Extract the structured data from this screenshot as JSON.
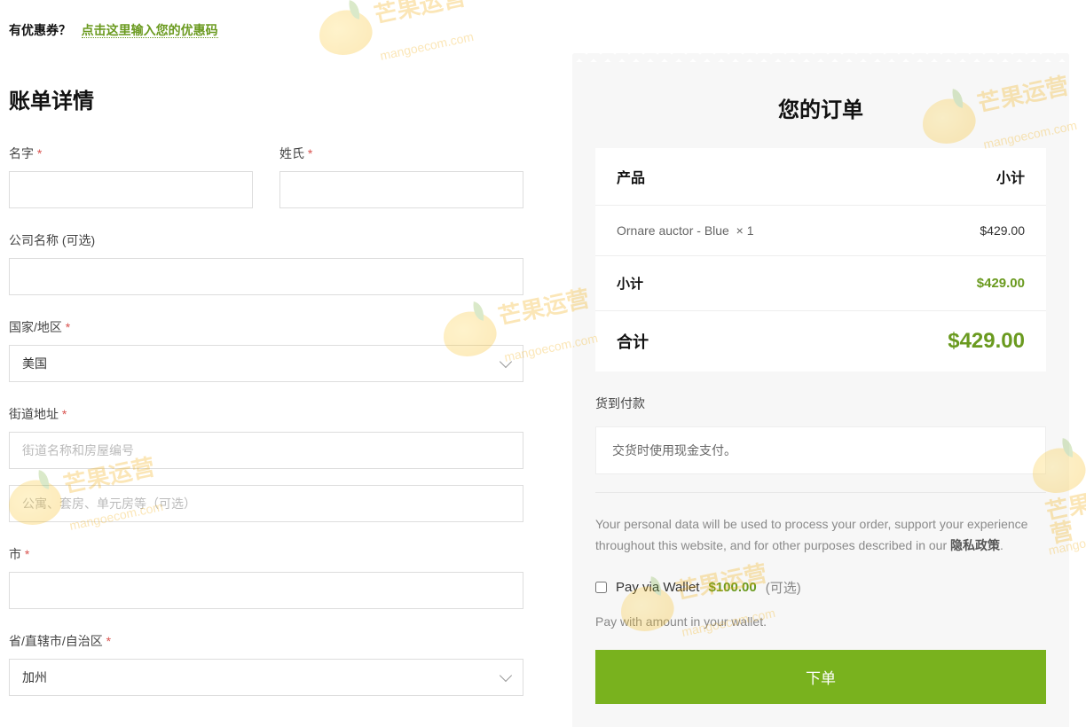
{
  "coupon": {
    "prompt": "有优惠券？",
    "link": "点击这里输入您的优惠码"
  },
  "billing": {
    "title": "账单详情",
    "first_name_label": "名字",
    "last_name_label": "姓氏",
    "company_label": "公司名称 (可选)",
    "country_label": "国家/地区",
    "country_value": "美国",
    "street_label": "街道地址",
    "street_placeholder_1": "街道名称和房屋编号",
    "street_placeholder_2": "公寓、套房、单元房等（可选）",
    "city_label": "市",
    "state_label": "省/直辖市/自治区",
    "state_value": "加州"
  },
  "order": {
    "title": "您的订单",
    "head_product": "产品",
    "head_subtotal": "小计",
    "item_name": "Ornare auctor - Blue",
    "item_qty": "× 1",
    "item_price": "$429.00",
    "sub_label": "小计",
    "sub_value": "$429.00",
    "total_label": "合计",
    "total_value": "$429.00"
  },
  "payment": {
    "method_label": "货到付款",
    "method_desc": "交货时使用现金支付。",
    "privacy_prefix": "Your personal data will be used to process your order, support your experience throughout this website, and for other purposes described in our ",
    "privacy_link": "隐私政策",
    "wallet_label": "Pay via Wallet",
    "wallet_amount": "$100.00",
    "wallet_optional": "(可选)",
    "wallet_desc": "Pay with amount in your wallet.",
    "place_order": "下单"
  },
  "required_mark": "*",
  "watermark": {
    "text": "芒果运营",
    "url": "mangoecom.com"
  }
}
